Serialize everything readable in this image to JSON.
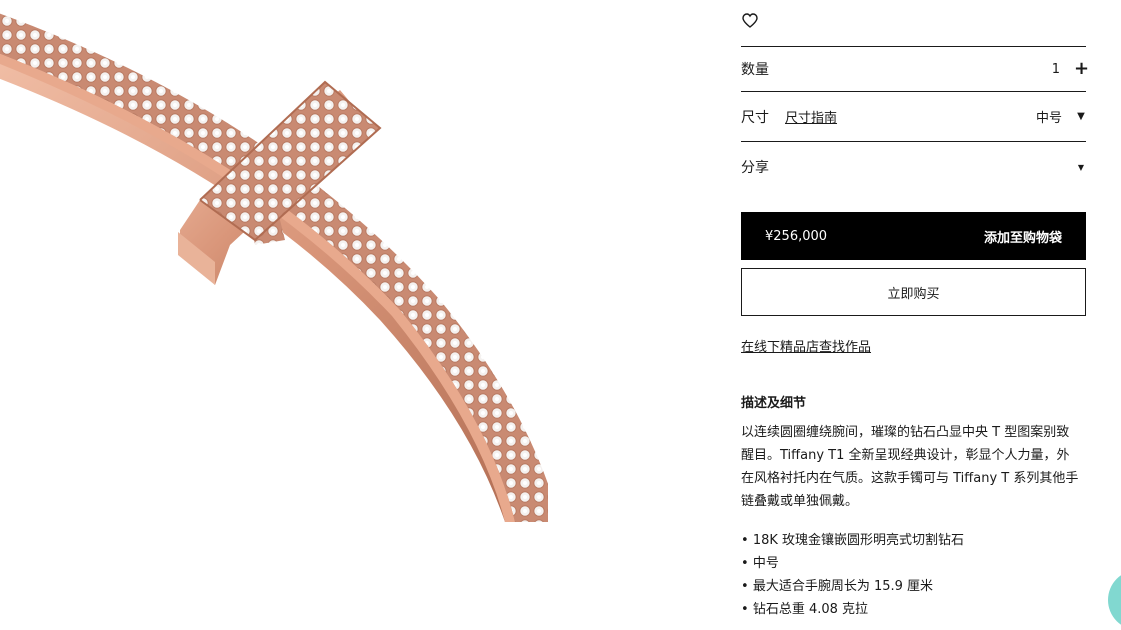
{
  "product": {
    "image_alt": "T1 bangle",
    "quantity_label": "数量",
    "quantity_value": "1",
    "size_label": "尺寸",
    "size_guide_link": "尺寸指南",
    "size_value": "中号",
    "share_label": "分享",
    "price": "¥256,000",
    "add_to_bag": "添加至购物袋",
    "buy_now": "立即购买",
    "find_in_store": "在线下精品店查找作品"
  },
  "description": {
    "title": "描述及细节",
    "body": "以连续圆圈缠绕腕间，璀璨的钻石凸显中央 T 型图案别致醒目。Tiffany T1 全新呈现经典设计，彰显个人力量，外在风格衬托内在气质。这款手镯可与 Tiffany T 系列其他手链叠戴或单独佩戴。",
    "specs": [
      "18K 玫瑰金镶嵌圆形明亮式切割钻石",
      "中号",
      "最大适合手腕周长为 15.9 厘米",
      "钻石总重 4.08 克拉"
    ]
  },
  "colors": {
    "accent": "#000000",
    "chat": "#81d8d0",
    "gold": "#d9967a"
  },
  "icons": {
    "wishlist": "heart-icon",
    "quantity": "plus-icon",
    "size": "caret-down-icon",
    "share": "caret-down-icon"
  }
}
